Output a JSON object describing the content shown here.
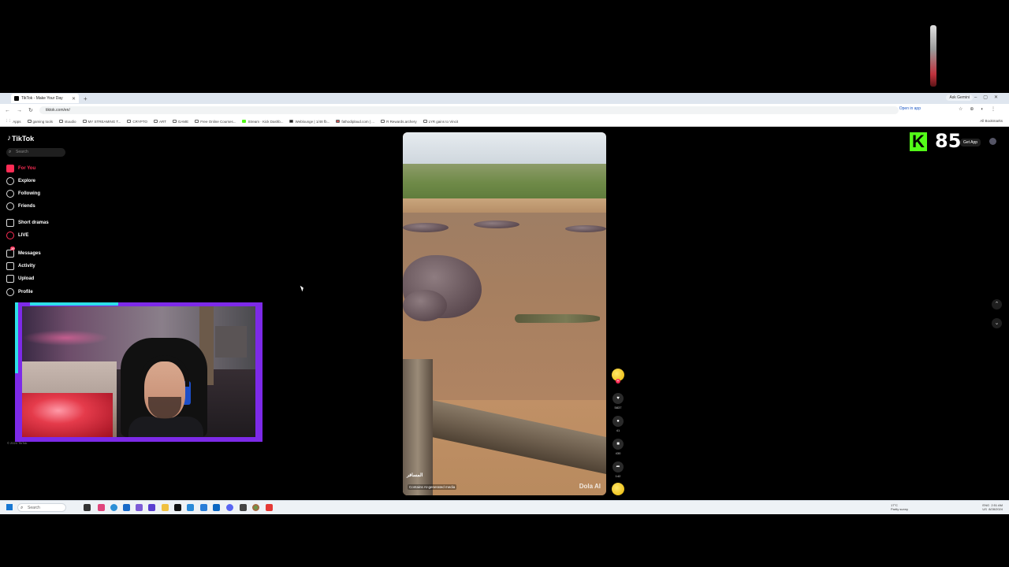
{
  "browser": {
    "tab_title": "TikTok - Make Your Day",
    "new_tab": "+",
    "ask_gemini": "Ask Gemini",
    "url": "tiktok.com/en/",
    "open_in_app": "Open in app",
    "bookmarks": [
      "Apps",
      "gaming tools",
      "stuudio",
      "MY STREAMING T...",
      "CRYPTO",
      "ART",
      "GAME",
      "Free Online Courses...",
      "Stream · Kick Dashb...",
      "Weblounge | 1/48 fb...",
      "fathodiplaud.com | ...",
      "R Rewards.archery",
      "LYR gains to Vincit"
    ],
    "all_bookmarks": "All Bookmarks"
  },
  "tiktok": {
    "logo": "TikTok",
    "search_placeholder": "Search",
    "nav": [
      {
        "label": "For You",
        "icon": "home-icon"
      },
      {
        "label": "Explore",
        "icon": "compass-icon"
      },
      {
        "label": "Following",
        "icon": "following-icon"
      },
      {
        "label": "Friends",
        "icon": "friends-icon"
      },
      {
        "label": "Short dramas",
        "icon": "dramas-icon"
      },
      {
        "label": "LIVE",
        "icon": "live-icon"
      },
      {
        "label": "Messages",
        "icon": "messages-icon"
      },
      {
        "label": "Activity",
        "icon": "activity-icon"
      },
      {
        "label": "Upload",
        "icon": "upload-icon"
      },
      {
        "label": "Profile",
        "icon": "profile-icon"
      }
    ],
    "messages_badge": "10",
    "copyright": "© 2024 TikTok",
    "get_app": "Get App"
  },
  "video": {
    "author": "المسافر",
    "ai_label": "Contains AI-generated media",
    "watermark": "Dola AI",
    "likes": "5837",
    "comments": "41",
    "saves": "430",
    "shares": "142"
  },
  "stream_overlay": {
    "kick_logo": "K",
    "viewer_count": "85",
    "brand_color": "#53fc18",
    "cam_border_color": "#7d2ae8"
  },
  "taskbar": {
    "search": "Search",
    "weather_temp": "17°C",
    "weather_desc": "Partly sunny",
    "lang": "ENG",
    "region": "US",
    "time": "2:51 AM",
    "date": "8/28/2024"
  }
}
